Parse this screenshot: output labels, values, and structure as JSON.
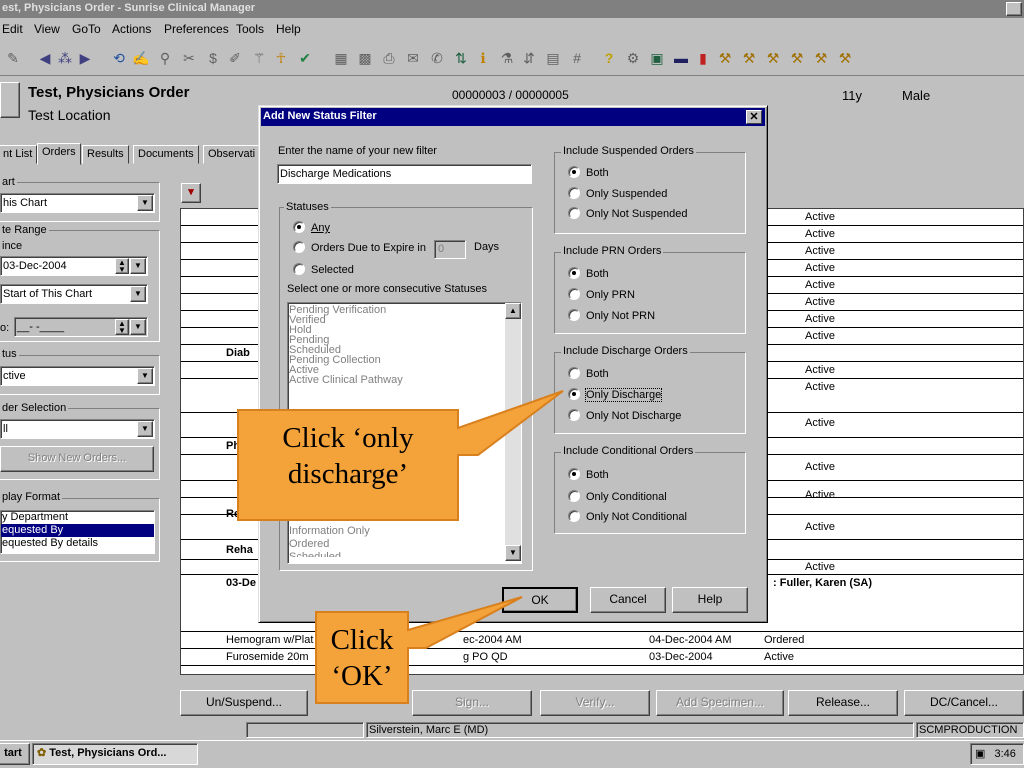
{
  "window": {
    "title": "est, Physicians Order - Sunrise Clinical Manager",
    "menu": [
      "Edit",
      "View",
      "GoTo",
      "Actions",
      "Preferences",
      "Tools",
      "Help"
    ]
  },
  "header": {
    "patient_name": "Test, Physicians Order",
    "location": "Test Location",
    "id_numbers": "00000003 / 00000005",
    "age": "11y",
    "sex": "Male"
  },
  "tabs": [
    "nt List",
    "Orders",
    "Results",
    "Documents",
    "Observati"
  ],
  "left_panel": {
    "chart_label": "art",
    "chart_value": "his Chart",
    "date_range_label": "te Range",
    "since_label": "ince",
    "since_date": "03-Dec-2004",
    "start_of_chart": "Start of This Chart",
    "to_label": "o:",
    "to_value": "__-  -____",
    "status_label": "tus",
    "status_value": "ctive",
    "order_selection_label": "der Selection",
    "order_selection_value": "ll",
    "show_new_orders": "Show New Orders...",
    "display_format_label": "play Format",
    "display_format_items": [
      "y Department",
      "equested By",
      "equested By details"
    ]
  },
  "grid": {
    "status_active": "Active",
    "group_labels": [
      "Diab",
      "Ph",
      "Re",
      "Reha"
    ],
    "date_group": "03-De",
    "requester": ":  Fuller, Karen (SA)",
    "row1": {
      "name": "Hemogram w/Plat",
      "ordered": "ec-2004 AM",
      "date": "04-Dec-2004 AM",
      "status": "Ordered"
    },
    "row2": {
      "name": "Furosemide  20m",
      "ordered": "g PO QD",
      "date": "03-Dec-2004",
      "status": "Active"
    }
  },
  "bottom_buttons": [
    "Un/Suspend...",
    "Sign...",
    "Verify...",
    "Add Specimen...",
    "Release...",
    "DC/Cancel..."
  ],
  "status_bar": {
    "user": "Silverstein, Marc E (MD)",
    "env": "SCMPRODUCTION"
  },
  "taskbar": {
    "start": "tart",
    "task": "Test, Physicians Ord...",
    "clock": "3:46"
  },
  "dialog": {
    "title": "Add New Status Filter",
    "name_prompt": "Enter the name of your new filter",
    "name_value": "Discharge Medications",
    "statuses_label": "Statuses",
    "opt_any": "Any",
    "opt_expire": "Orders Due to Expire in",
    "expire_days_value": "0",
    "days_label": "Days",
    "opt_selected": "Selected",
    "select_prompt": "Select one or more consecutive Statuses",
    "status_list": [
      "Pending Verification",
      "Verified",
      "Hold",
      "Pending",
      "Scheduled",
      "Pending Collection",
      "Active",
      "Active Clinical Pathway"
    ],
    "status_list_lower": [
      "Information Only",
      "Ordered",
      "Scheduled"
    ],
    "suspended_label": "Include Suspended Orders",
    "suspended_opts": [
      "Both",
      "Only Suspended",
      "Only Not Suspended"
    ],
    "prn_label": "Include PRN Orders",
    "prn_opts": [
      "Both",
      "Only PRN",
      "Only Not PRN"
    ],
    "discharge_label": "Include Discharge Orders",
    "discharge_opts": [
      "Both",
      "Only Discharge",
      "Only Not Discharge"
    ],
    "conditional_label": "Include Conditional Orders",
    "conditional_opts": [
      "Both",
      "Only Conditional",
      "Only Not Conditional"
    ],
    "ok": "OK",
    "cancel": "Cancel",
    "help": "Help"
  },
  "callouts": {
    "discharge": "Click ‘only discharge’",
    "ok": "Click ‘OK’"
  },
  "colors": {
    "dialog_title_bg": "#000080",
    "callout_fill": "#f4a23a",
    "callout_border": "#d9801e"
  }
}
